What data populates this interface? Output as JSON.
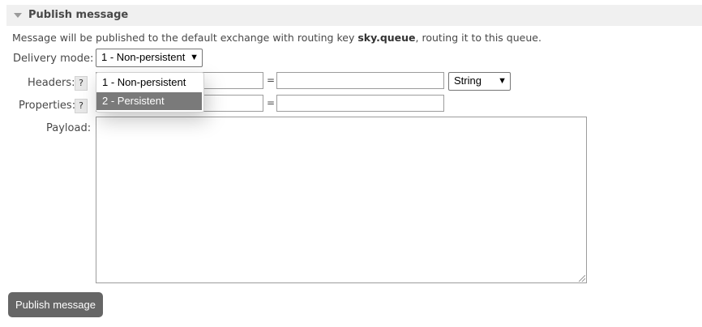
{
  "section": {
    "title": "Publish message",
    "toggle_icon": "triangle-down-icon"
  },
  "description": {
    "before": "Message will be published to the default exchange with routing key ",
    "key": "sky.queue",
    "after": ", routing it to this queue."
  },
  "delivery": {
    "label": "Delivery mode:",
    "selected": "1 - Non-persistent",
    "options": [
      "1 - Non-persistent",
      "2 - Persistent"
    ]
  },
  "headers": {
    "label": "Headers:",
    "help": "?",
    "eq": "=",
    "type_selected": "String"
  },
  "properties": {
    "label": "Properties:",
    "help": "?",
    "eq": "="
  },
  "payload": {
    "label": "Payload:"
  },
  "button": {
    "label": "Publish message"
  },
  "colors": {
    "button_bg": "#666666",
    "highlight": "#7a7a7a",
    "header_bg": "#f0f0f0"
  }
}
